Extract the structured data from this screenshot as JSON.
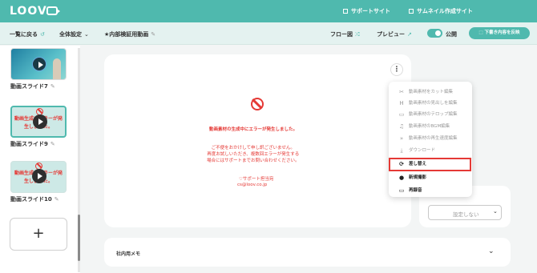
{
  "header": {
    "logo_text": "LOOV",
    "links": [
      "サポートサイト",
      "サムネイル作成サイト"
    ]
  },
  "toolbar": {
    "back_label": "一覧に戻る",
    "settings_label": "全体設定",
    "project_title": "★内部検証用動画",
    "flow_label": "フロー図",
    "preview_label": "プレビュー",
    "public_label": "公開",
    "reflect_label": "下書き内容を反映"
  },
  "sidebar": {
    "slides": [
      {
        "label": "動画スライド7",
        "status": "ok"
      },
      {
        "label": "動画スライド9",
        "status": "error",
        "thumb_text": [
          "動画生成でエラーが発",
          "生しました。"
        ]
      },
      {
        "label": "動画スライド10",
        "status": "error",
        "thumb_text": [
          "動画生成でエラーが発",
          "生しました。"
        ]
      }
    ],
    "add_label": "+"
  },
  "main": {
    "error_title": "動画素材の生成中にエラーが発生しました。",
    "error_body": [
      "ご不便をおかけして申し訳ございません。",
      "再度お試しいただき、複数回エラーが発生する",
      "場合にはサポートまでお問い合わせください。"
    ],
    "support_name": "♡サポート担当宛",
    "support_email": "cs@loov.co.jp",
    "kebab_label": "⋮"
  },
  "menu": {
    "items": [
      {
        "label": "動画素材をカット編集",
        "icon": "scissors-icon",
        "glyph": "✂",
        "enabled": false
      },
      {
        "label": "動画素材の見出しを編集",
        "icon": "heading-icon",
        "glyph": "H",
        "enabled": false
      },
      {
        "label": "動画素材のテロップ編集",
        "icon": "caption-icon",
        "glyph": "▭",
        "enabled": false
      },
      {
        "label": "動画素材のBGM編集",
        "icon": "music-icon",
        "glyph": "♫",
        "enabled": false
      },
      {
        "label": "動画素材の再生速度編集",
        "icon": "speed-icon",
        "glyph": "»",
        "enabled": false
      },
      {
        "label": "ダウンロード",
        "icon": "download-icon",
        "glyph": "⤓",
        "enabled": false
      },
      {
        "label": "差し替え",
        "icon": "replace-icon",
        "glyph": "⟳",
        "enabled": true
      },
      {
        "label": "新規撮影",
        "icon": "camera-icon",
        "glyph": "●",
        "enabled": true
      },
      {
        "label": "再録音",
        "icon": "video-icon",
        "glyph": "▭",
        "enabled": true
      }
    ],
    "highlighted": "差し替え"
  },
  "right_panel": {
    "label": "",
    "select_value": "設定しない"
  },
  "memo": {
    "label": "社内用メモ"
  },
  "colors": {
    "accent": "#4fb9ae",
    "error": "#e53935"
  }
}
